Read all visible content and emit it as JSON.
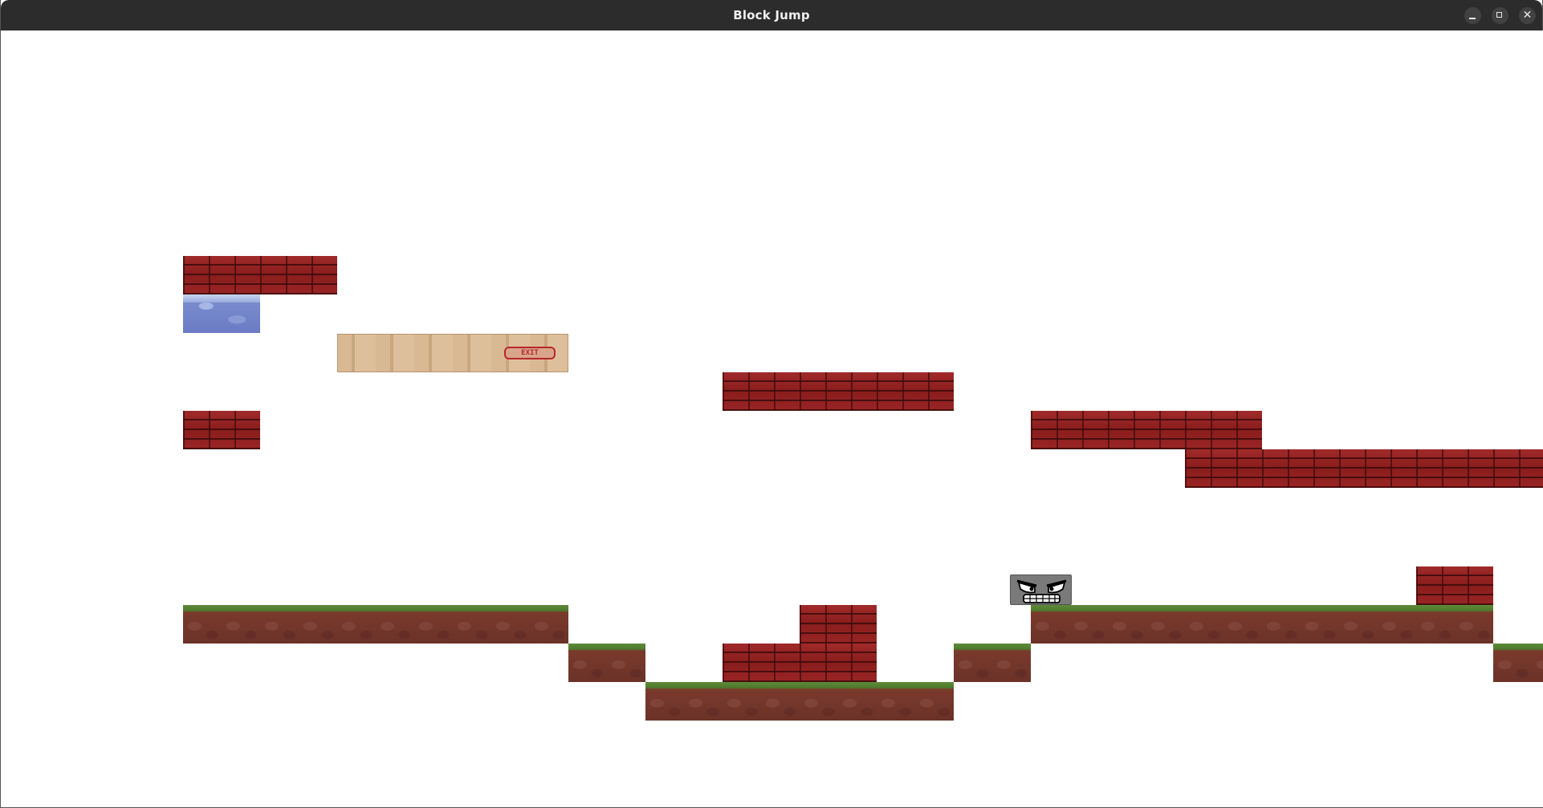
{
  "window": {
    "title": "Block Jump",
    "controls": {
      "minimize_icon": "minimize-icon",
      "maximize_icon": "maximize-icon",
      "close_icon": "close-icon",
      "close_glyph": "✕"
    }
  },
  "scene": {
    "background": "#ffffff",
    "tile_colors": {
      "brick": "#8e1f1f",
      "grass_top": "#5f8a3a",
      "dirt": "#6b3228",
      "water": "#6a7bc4",
      "sign": "#d6b690",
      "player": "#7a7a7a"
    },
    "sign_text": "EXIT",
    "player_face": "angry-face-icon"
  }
}
